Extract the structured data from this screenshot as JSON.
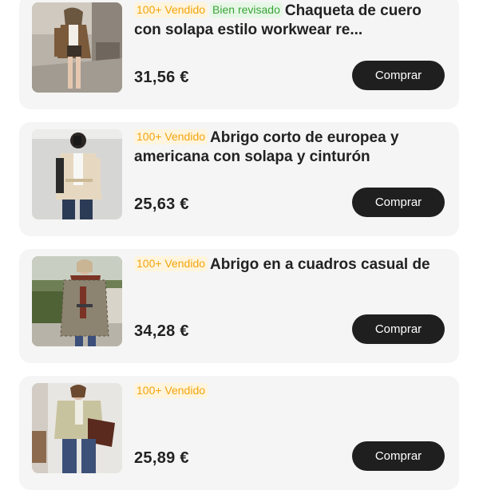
{
  "products": [
    {
      "badges": [
        {
          "text": "100+ Vendido",
          "type": "sold"
        },
        {
          "text": "Bien revisado",
          "type": "checked"
        }
      ],
      "title": "Chaqueta de cuero con solapa estilo workwear re...",
      "price": "31,56 €",
      "button": "Comprar",
      "image": "woman-in-brown-leather-jacket-icon"
    },
    {
      "badges": [
        {
          "text": "100+ Vendido",
          "type": "sold"
        }
      ],
      "title": "Abrigo corto de europea y americana con solapa y cinturón",
      "price": "25,63 €",
      "button": "Comprar",
      "image": "woman-in-beige-short-coat-icon"
    },
    {
      "badges": [
        {
          "text": "100+ Vendido",
          "type": "sold"
        }
      ],
      "title": "Abrigo en a cuadros casual de",
      "price": "34,28 €",
      "button": "Comprar",
      "image": "woman-in-plaid-coat-icon"
    },
    {
      "badges": [
        {
          "text": "100+ Vendido",
          "type": "sold"
        }
      ],
      "title": "",
      "price": "25,89 €",
      "button": "Comprar",
      "image": "woman-in-green-jacket-icon"
    }
  ],
  "colors": {
    "sold_badge": "#f2a50d",
    "checked_badge": "#3aa43a",
    "button_bg": "#1f1f1f",
    "card_bg": "#f5f5f5"
  }
}
